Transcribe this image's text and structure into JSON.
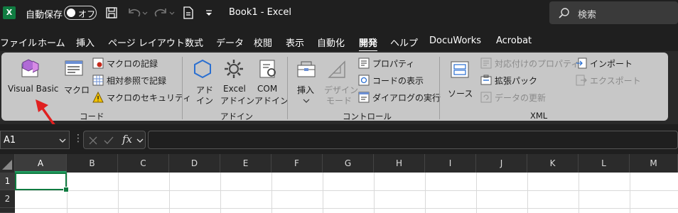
{
  "titlebar": {
    "app_icon": "X",
    "autosave_label": "自動保存",
    "autosave_state": "オフ",
    "doc_title": "Book1  -  Excel",
    "search_placeholder": "検索"
  },
  "tabs": [
    "ファイル",
    "ホーム",
    "挿入",
    "ページ レイアウト",
    "数式",
    "データ",
    "校閲",
    "表示",
    "自動化",
    "開発",
    "ヘルプ",
    "DocuWorks",
    "Acrobat"
  ],
  "active_tab": "開発",
  "ribbon": {
    "code": {
      "visual_basic": "Visual Basic",
      "macro": "マクロ",
      "record_macro": "マクロの記録",
      "relative_ref": "相対参照で記録",
      "macro_security": "マクロのセキュリティ",
      "group_label": "コード"
    },
    "addins": {
      "addin_line1": "アド",
      "addin_line2": "イン",
      "excel_addin_line1": "Excel",
      "excel_addin_line2": "アドイン",
      "com_addin_line1": "COM",
      "com_addin_line2": "アドイン",
      "group_label": "アドイン"
    },
    "controls": {
      "insert": "挿入",
      "design_mode_line1": "デザイン",
      "design_mode_line2": "モード",
      "properties": "プロパティ",
      "view_code": "コードの表示",
      "run_dialog": "ダイアログの実行",
      "group_label": "コントロール"
    },
    "xml": {
      "source": "ソース",
      "map_properties": "対応付けのプロパティ",
      "expansion_packs": "拡張パック",
      "refresh_data": "データの更新",
      "import": "インポート",
      "export": "エクスポート",
      "group_label": "XML"
    }
  },
  "formula_bar": {
    "name_box": "A1",
    "fx": "fx",
    "formula": ""
  },
  "grid": {
    "columns": [
      "A",
      "B",
      "C",
      "D",
      "E",
      "F",
      "G",
      "H",
      "I",
      "J",
      "K",
      "L",
      "M"
    ],
    "rows": [
      "1",
      "2"
    ],
    "selected_cell": "A1"
  },
  "colors": {
    "excel_green": "#107c41",
    "annotation_arrow": "#e02020",
    "ribbon_bg": "#c7c7c7"
  }
}
